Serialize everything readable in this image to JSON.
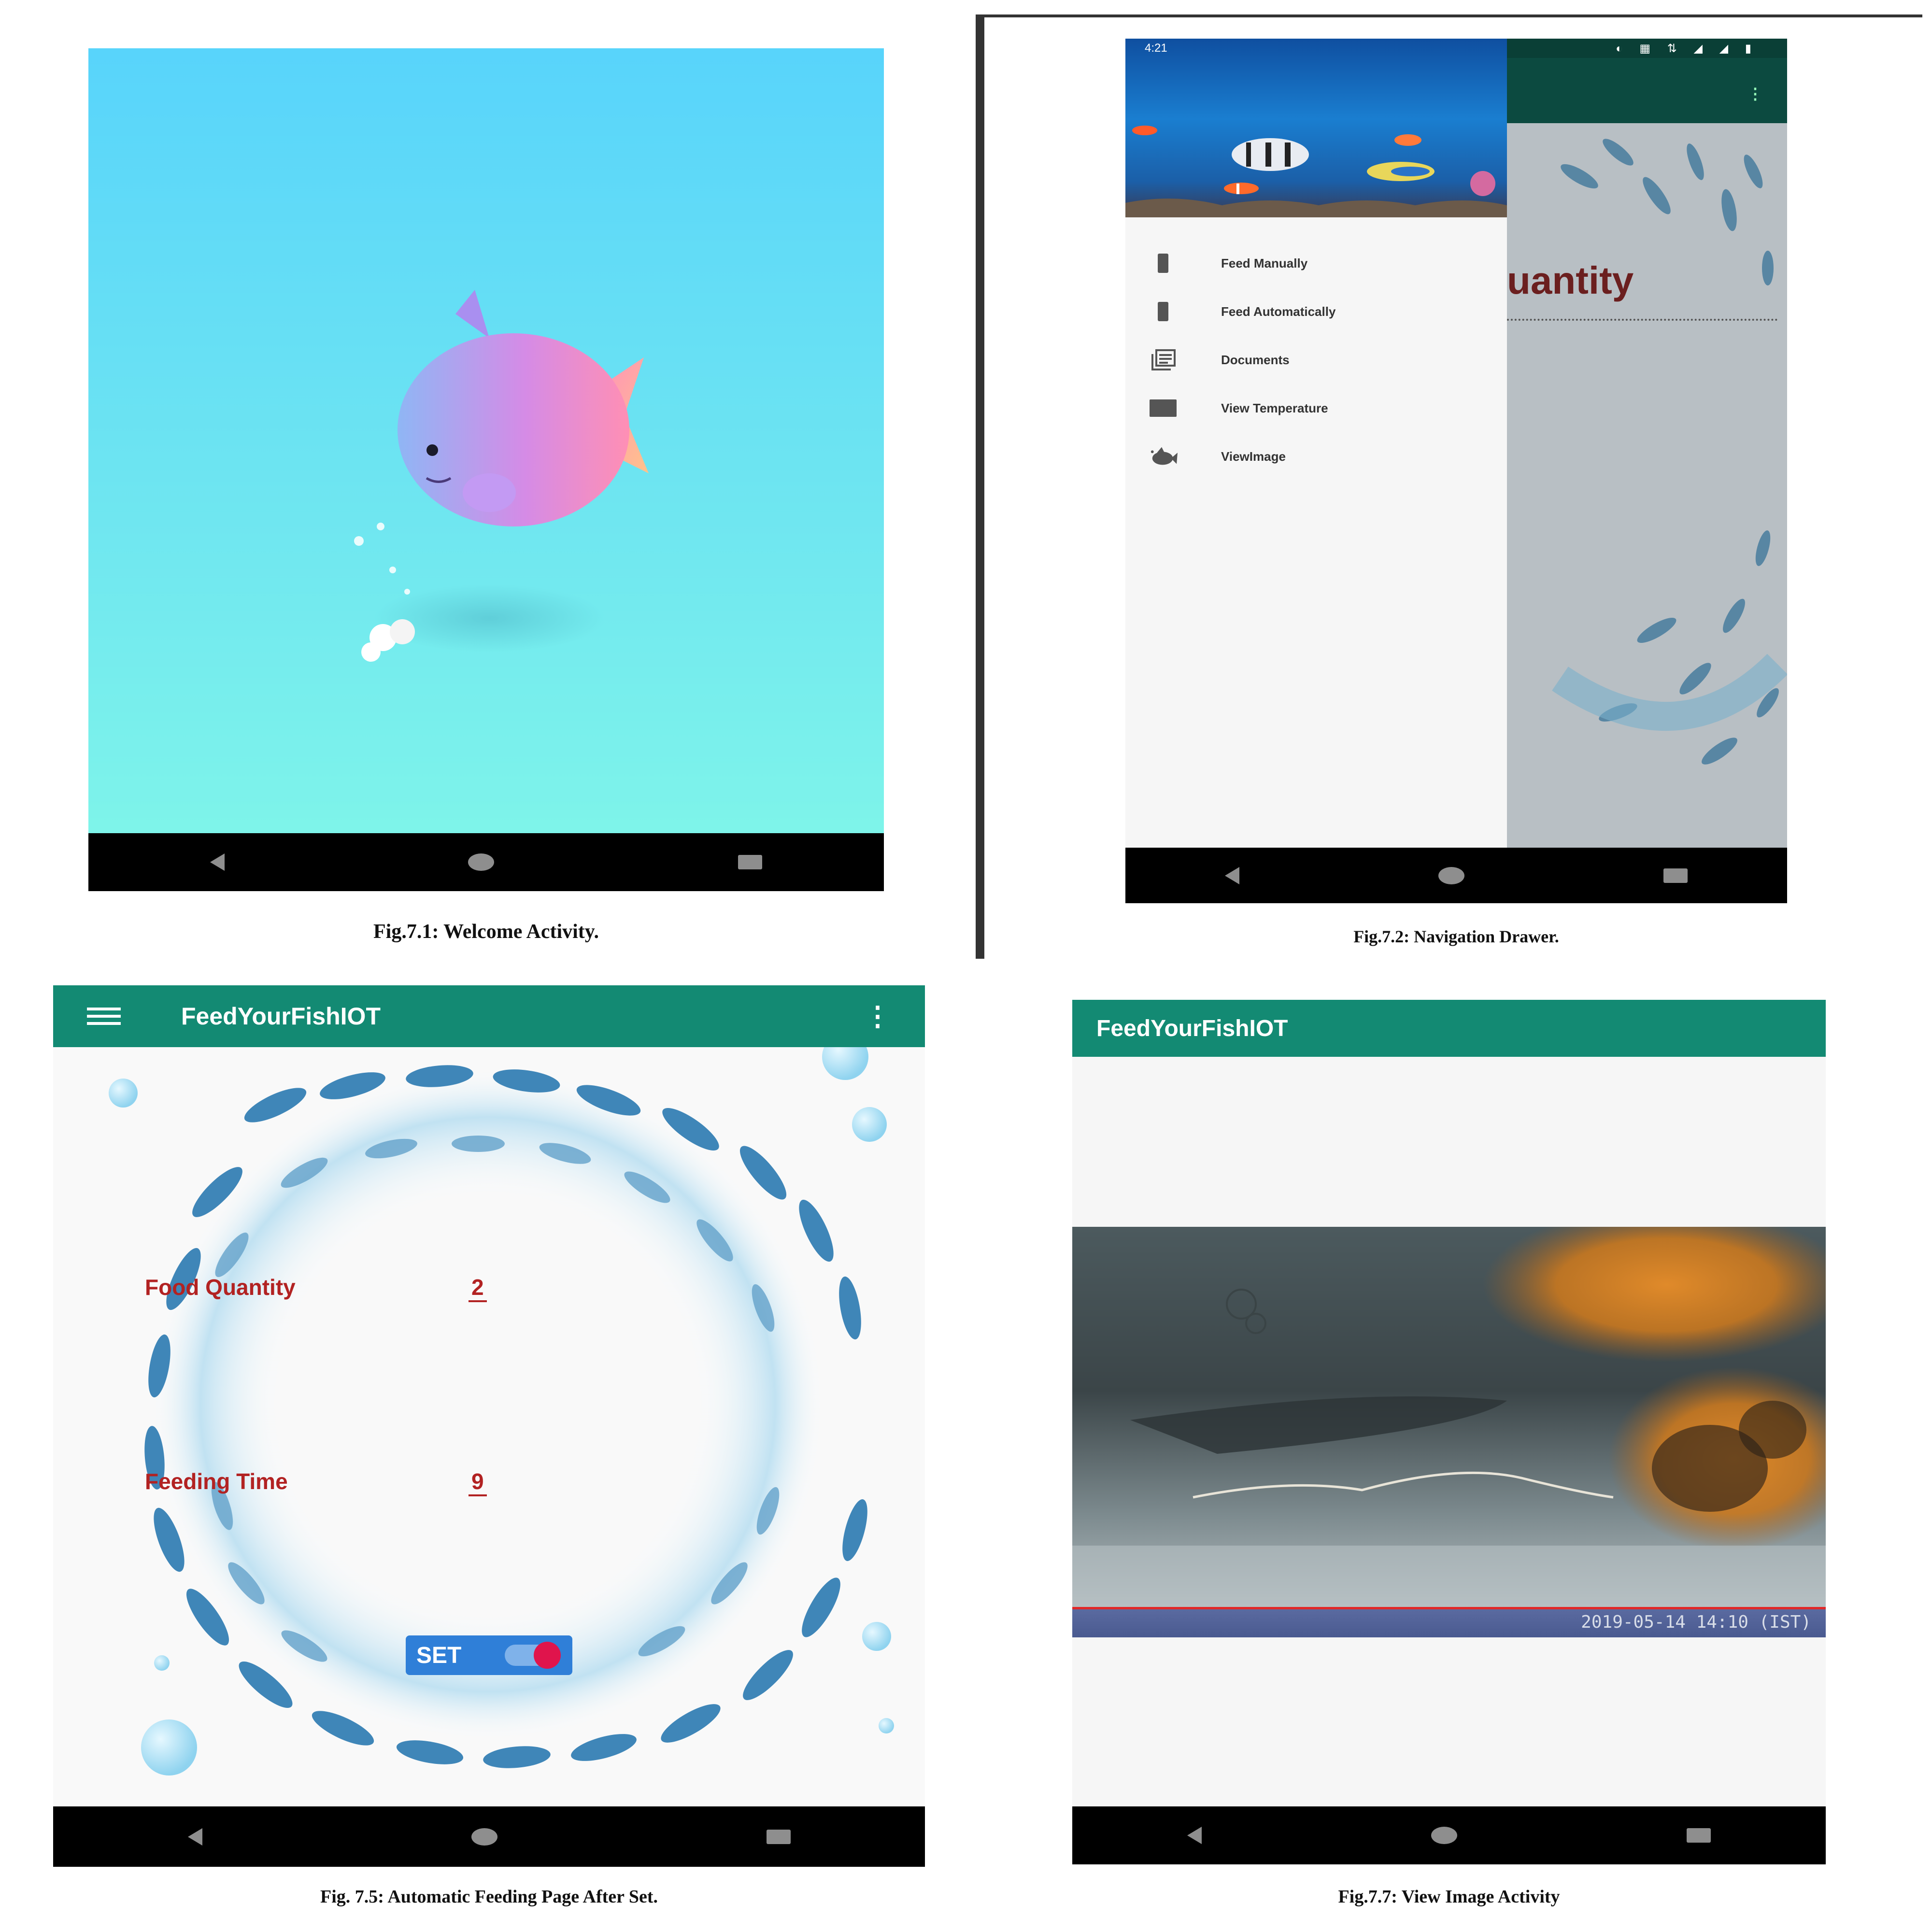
{
  "panels": {
    "welcome": {
      "caption": "Fig.7.1: Welcome Activity."
    },
    "drawer": {
      "caption": "Fig.7.2: Navigation Drawer.",
      "status_time": "4:21",
      "overflow_icon": "more-vert-icon",
      "background_heading": "uantity",
      "items": [
        {
          "label": "Feed Manually",
          "icon": "device-icon"
        },
        {
          "label": "Feed Automatically",
          "icon": "device-icon"
        },
        {
          "label": "Documents",
          "icon": "documents-icon"
        },
        {
          "label": "View Temperature",
          "icon": "thermometer-box-icon"
        },
        {
          "label": "ViewImage",
          "icon": "fish-icon"
        }
      ]
    },
    "auto_feeding": {
      "caption": "Fig. 7.5: Automatic Feeding Page After Set.",
      "app_title": "FeedYourFishIOT",
      "food_quantity_label": "Food Quantity",
      "food_quantity_value": "2",
      "feeding_time_label": "Feeding Time",
      "feeding_time_value": "9",
      "set_label": "SET",
      "set_toggle_on": true
    },
    "view_image": {
      "caption": "Fig.7.7: View Image Activity",
      "app_title": "FeedYourFishIOT",
      "image_timestamp": "2019-05-14 14:10 (IST)"
    }
  },
  "colors": {
    "appbar": "#138a73",
    "label_red": "#b22222",
    "fish_blue": "#3f86b8",
    "set_button": "#2f7fd8"
  }
}
